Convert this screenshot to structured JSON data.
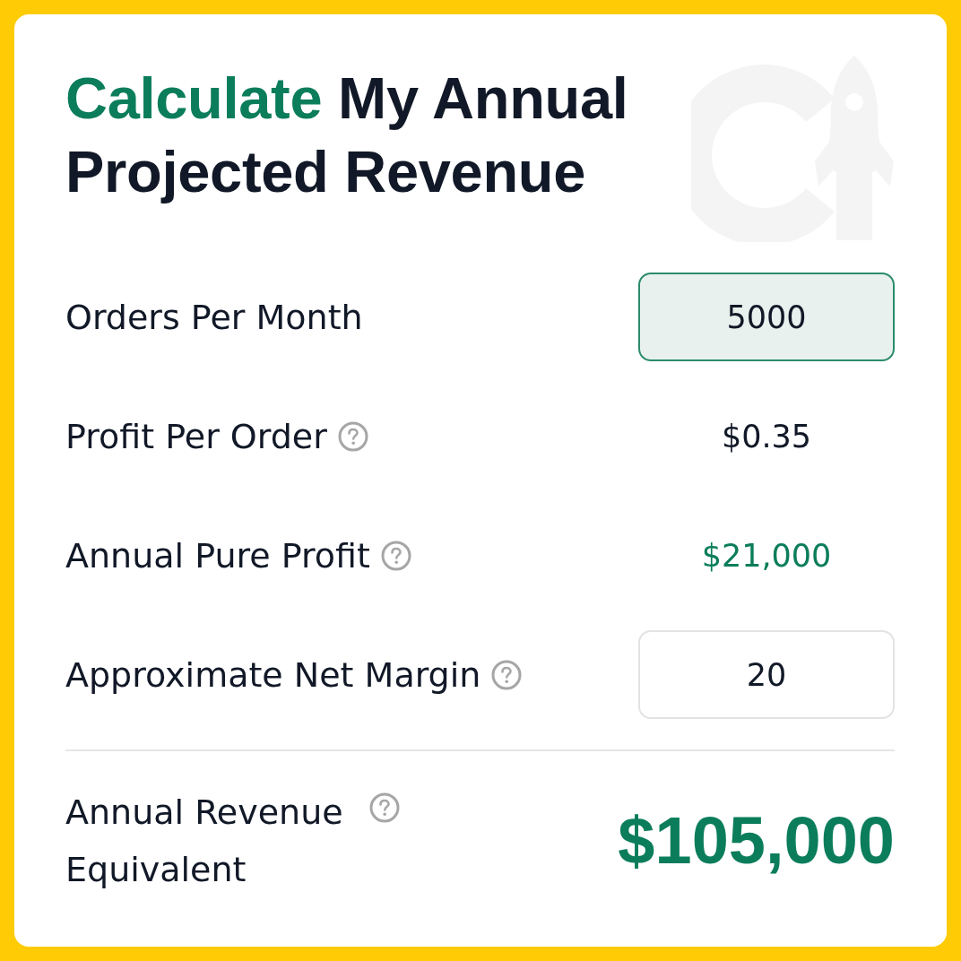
{
  "title": {
    "highlight": "Calculate",
    "rest": "My Annual Projected Revenue"
  },
  "rows": [
    {
      "kind": "input",
      "label": "Orders Per Month",
      "help": false,
      "value": "5000",
      "focused": true
    },
    {
      "kind": "text",
      "label": "Profit Per Order",
      "help": true,
      "value": "$0.35",
      "accent": false
    },
    {
      "kind": "text",
      "label": "Annual Pure Profit",
      "help": true,
      "value": "$21,000",
      "accent": true
    },
    {
      "kind": "input",
      "label": "Approximate Net Margin",
      "help": true,
      "value": "20",
      "focused": false
    }
  ],
  "total": {
    "label": "Annual Revenue Equivalent",
    "help": true,
    "value": "$105,000"
  }
}
